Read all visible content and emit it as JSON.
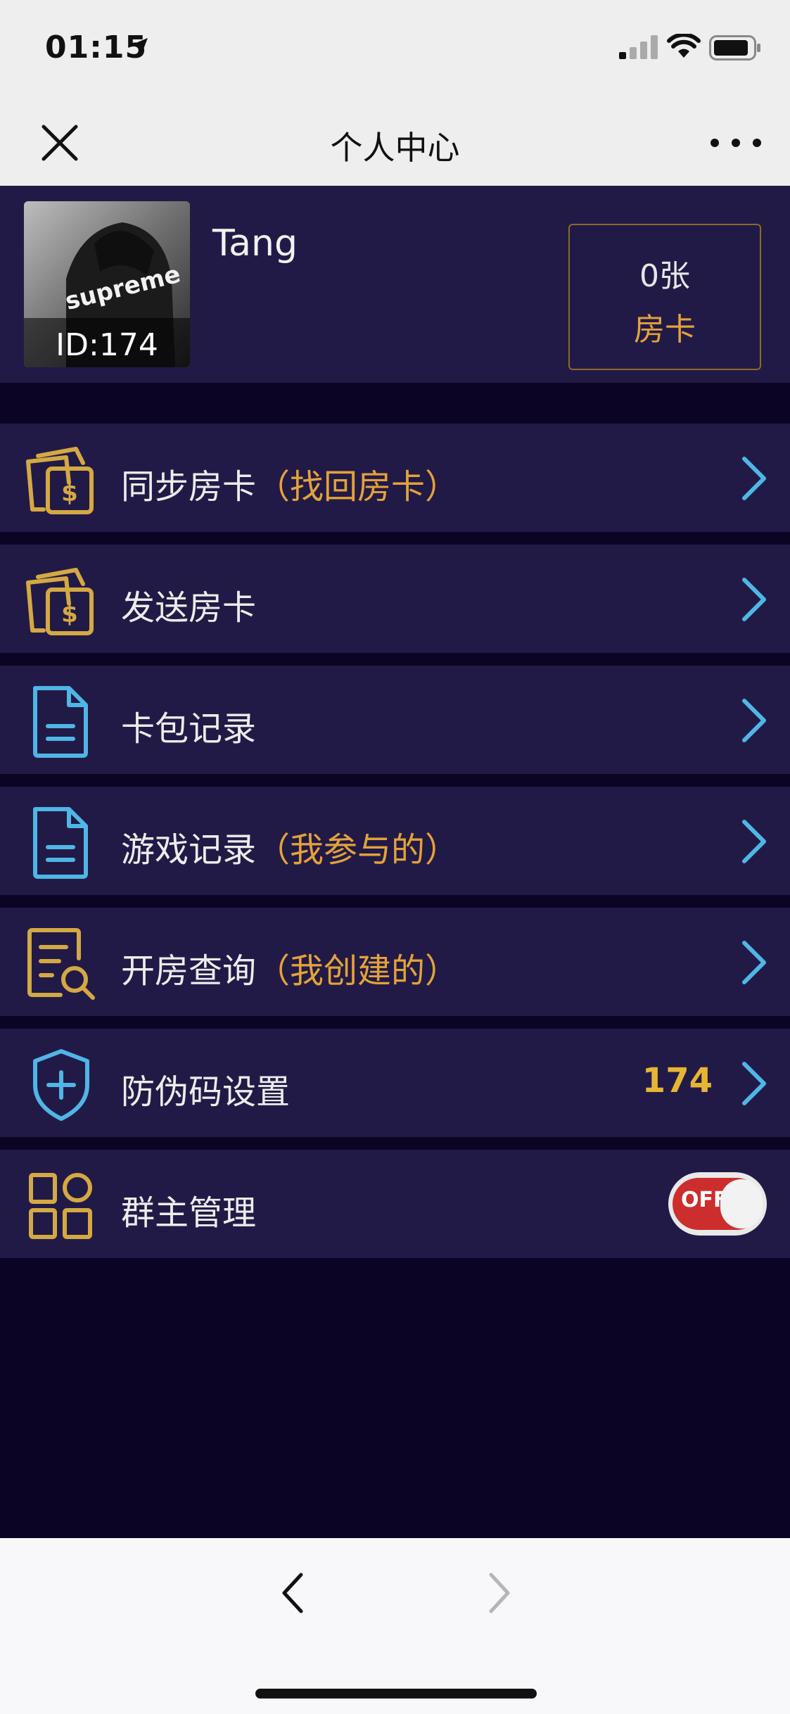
{
  "status_bar": {
    "time": "01:15"
  },
  "nav": {
    "title": "个人中心"
  },
  "profile": {
    "username": "Tang",
    "id_label": "ID:174",
    "avatar_text": "supreme",
    "card_count": "0张",
    "card_label": "房卡"
  },
  "menu": [
    {
      "label": "同步房卡",
      "sub": "（找回房卡）",
      "icon": "money-cards-icon"
    },
    {
      "label": "发送房卡",
      "sub": "",
      "icon": "money-cards-icon"
    },
    {
      "label": "卡包记录",
      "sub": "",
      "icon": "document-icon"
    },
    {
      "label": "游戏记录",
      "sub": "（我参与的）",
      "icon": "document-icon"
    },
    {
      "label": "开房查询",
      "sub": "（我创建的）",
      "icon": "document-search-icon"
    },
    {
      "label": "防伪码设置",
      "sub": "",
      "value": "174",
      "icon": "shield-plus-icon"
    },
    {
      "label": "群主管理",
      "sub": "",
      "icon": "grid-icon",
      "toggle": "OFF"
    }
  ],
  "colors": {
    "background": "#0c0424",
    "row_background": "#221a46",
    "accent_orange": "#e3a23b",
    "accent_gold": "#e7b534",
    "icon_gold": "#d4a944",
    "icon_blue": "#4fb6e6",
    "toggle_off": "#cc2e2e"
  }
}
